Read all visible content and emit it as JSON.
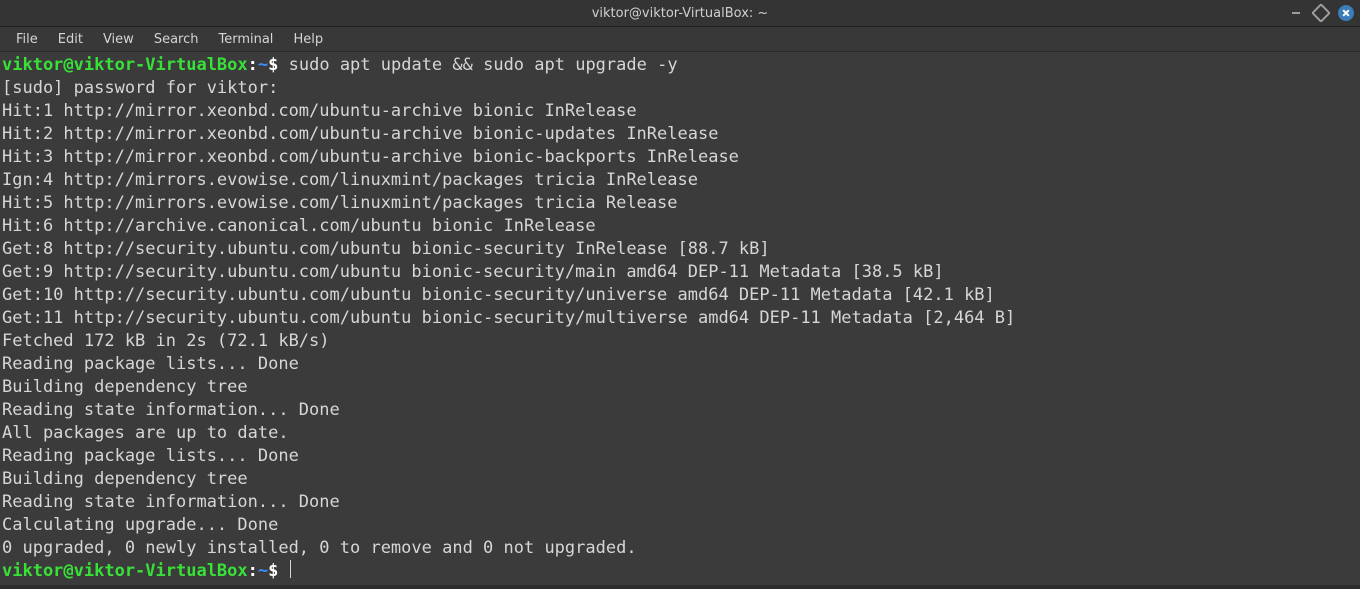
{
  "window": {
    "title": "viktor@viktor-VirtualBox: ~"
  },
  "menu": {
    "file": "File",
    "edit": "Edit",
    "view": "View",
    "search": "Search",
    "terminal": "Terminal",
    "help": "Help"
  },
  "prompt": {
    "user_host": "viktor@viktor-VirtualBox",
    "sep": ":",
    "cwd": "~",
    "sigil": "$"
  },
  "command": "sudo apt update && sudo apt upgrade -y",
  "lines": [
    "[sudo] password for viktor: ",
    "Hit:1 http://mirror.xeonbd.com/ubuntu-archive bionic InRelease",
    "Hit:2 http://mirror.xeonbd.com/ubuntu-archive bionic-updates InRelease",
    "Hit:3 http://mirror.xeonbd.com/ubuntu-archive bionic-backports InRelease",
    "Ign:4 http://mirrors.evowise.com/linuxmint/packages tricia InRelease",
    "Hit:5 http://mirrors.evowise.com/linuxmint/packages tricia Release",
    "Hit:6 http://archive.canonical.com/ubuntu bionic InRelease",
    "Get:8 http://security.ubuntu.com/ubuntu bionic-security InRelease [88.7 kB]",
    "Get:9 http://security.ubuntu.com/ubuntu bionic-security/main amd64 DEP-11 Metadata [38.5 kB]",
    "Get:10 http://security.ubuntu.com/ubuntu bionic-security/universe amd64 DEP-11 Metadata [42.1 kB]",
    "Get:11 http://security.ubuntu.com/ubuntu bionic-security/multiverse amd64 DEP-11 Metadata [2,464 B]",
    "Fetched 172 kB in 2s (72.1 kB/s)",
    "Reading package lists... Done",
    "Building dependency tree       ",
    "Reading state information... Done",
    "All packages are up to date.",
    "Reading package lists... Done",
    "Building dependency tree       ",
    "Reading state information... Done",
    "Calculating upgrade... Done",
    "0 upgraded, 0 newly installed, 0 to remove and 0 not upgraded."
  ]
}
